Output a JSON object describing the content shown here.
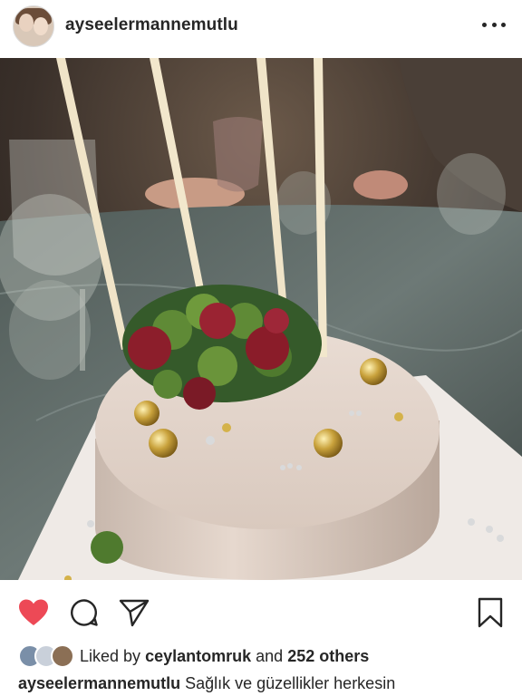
{
  "post": {
    "username": "ayseelermannemutlu",
    "avatar_icon": "profile-photo",
    "more_icon": "more-horizontal-icon"
  },
  "photo": {
    "subject": "birthday-cake-with-candles"
  },
  "actions": {
    "like_icon": "heart-filled-icon",
    "like_color": "#ed4956",
    "comment_icon": "comment-icon",
    "share_icon": "share-paper-plane-icon",
    "save_icon": "bookmark-icon"
  },
  "likes": {
    "prefix": "Liked by",
    "user": "ceylantomruk",
    "connector": "and",
    "others": "252 others"
  },
  "caption": {
    "username": "ayseelermannemutlu",
    "text": "Sağlık ve güzellikler herkesin"
  }
}
